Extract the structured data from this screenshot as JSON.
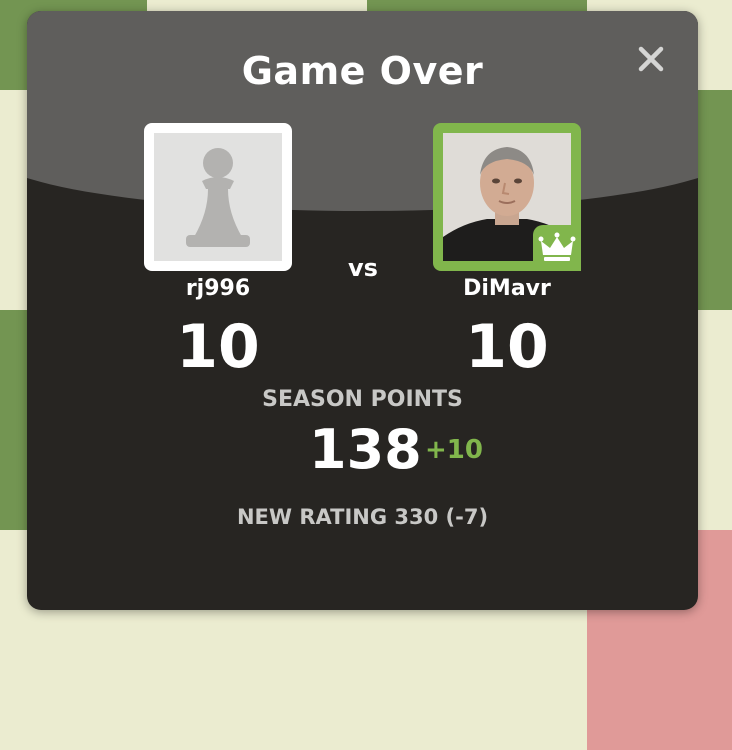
{
  "dialog": {
    "title": "Game Over",
    "close_icon": "close-icon",
    "vs_label": "vs"
  },
  "players": {
    "left": {
      "name": "rj996",
      "score": "10",
      "avatar_icon": "pawn-icon"
    },
    "right": {
      "name": "DiMavr",
      "score": "10",
      "avatar_icon": "player-photo",
      "badge_icon": "crown-icon"
    }
  },
  "season": {
    "label": "SEASON POINTS",
    "points": "138",
    "delta": "+10"
  },
  "rating": {
    "text": "NEW RATING 330 (-7)"
  },
  "colors": {
    "accent_green": "#81b64c",
    "modal_bg": "#272522",
    "modal_header": "#5f5e5c",
    "board_light": "#ebecd0",
    "board_dark": "#739552"
  }
}
